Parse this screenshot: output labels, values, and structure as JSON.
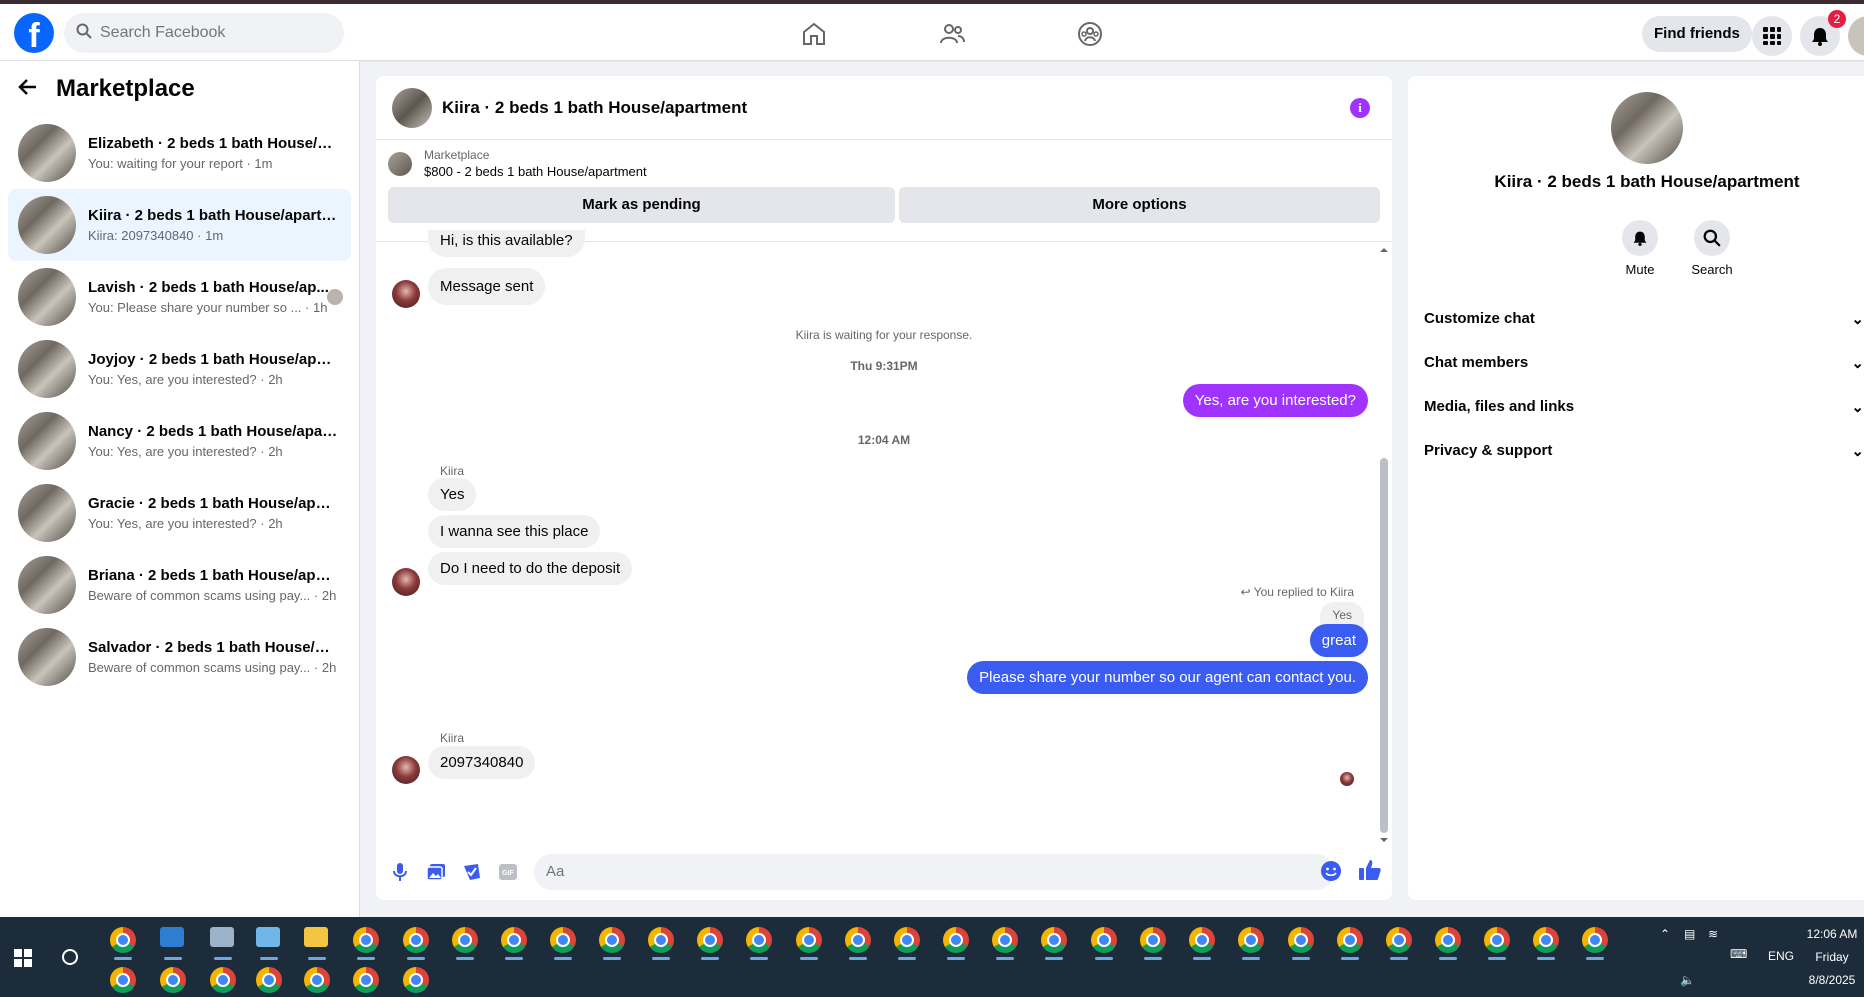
{
  "topbar": {
    "logo": "f",
    "search_placeholder": "Search Facebook",
    "find_friends": "Find friends",
    "notif_count": "2"
  },
  "left": {
    "title": "Marketplace",
    "conversations": [
      {
        "title": "Elizabeth · 2 beds 1 bath House/ap...",
        "sub": "You: waiting for your report · 1m"
      },
      {
        "title": "Kiira · 2 beds 1 bath House/apartm...",
        "sub": "Kiira: 2097340840 · 1m"
      },
      {
        "title": "Lavish · 2 beds 1 bath House/ap...",
        "sub": "You: Please share your number so ... · 1h"
      },
      {
        "title": "Joyjoy · 2 beds 1 bath House/apart...",
        "sub": "You: Yes, are you interested? · 2h"
      },
      {
        "title": "Nancy · 2 beds 1 bath House/apart...",
        "sub": "You: Yes, are you interested? · 2h"
      },
      {
        "title": "Gracie · 2 beds 1 bath House/apart...",
        "sub": "You: Yes, are you interested? · 2h"
      },
      {
        "title": "Briana · 2 beds 1 bath House/apart...",
        "sub": "Beware of common scams using pay... · 2h"
      },
      {
        "title": "Salvador · 2 beds 1 bath House/ap...",
        "sub": "Beware of common scams using pay... · 2h"
      }
    ]
  },
  "chat": {
    "title": "Kiira · 2 beds 1 bath House/apartment",
    "marketplace_label": "Marketplace",
    "listing": "$800 - 2 beds 1 bath House/apartment",
    "mark_pending": "Mark as pending",
    "more_options": "More options",
    "msg1": "Hi, is this available?",
    "msg2": "Message sent",
    "waiting": "Kiira is waiting for your response.",
    "time1": "Thu 9:31PM",
    "out1": "Yes, are you interested?",
    "time2": "12:04 AM",
    "sender1": "Kiira",
    "in1": "Yes",
    "in2": "I wanna see this place",
    "in3": "Do I need to do the deposit",
    "replied": "You replied to Kiira",
    "quoted": "Yes",
    "out2": "great",
    "out3": "Please share your number so our agent can contact you.",
    "sender2": "Kiira",
    "in4": "2097340840",
    "composer_placeholder": "Aa"
  },
  "right": {
    "title": "Kiira · 2 beds 1 bath House/apartment",
    "mute": "Mute",
    "search": "Search",
    "sections": [
      "Customize chat",
      "Chat members",
      "Media, files and links",
      "Privacy & support"
    ]
  },
  "taskbar": {
    "time": "12:06 AM",
    "day": "Friday",
    "date": "8/8/2025",
    "lang": "ENG"
  }
}
